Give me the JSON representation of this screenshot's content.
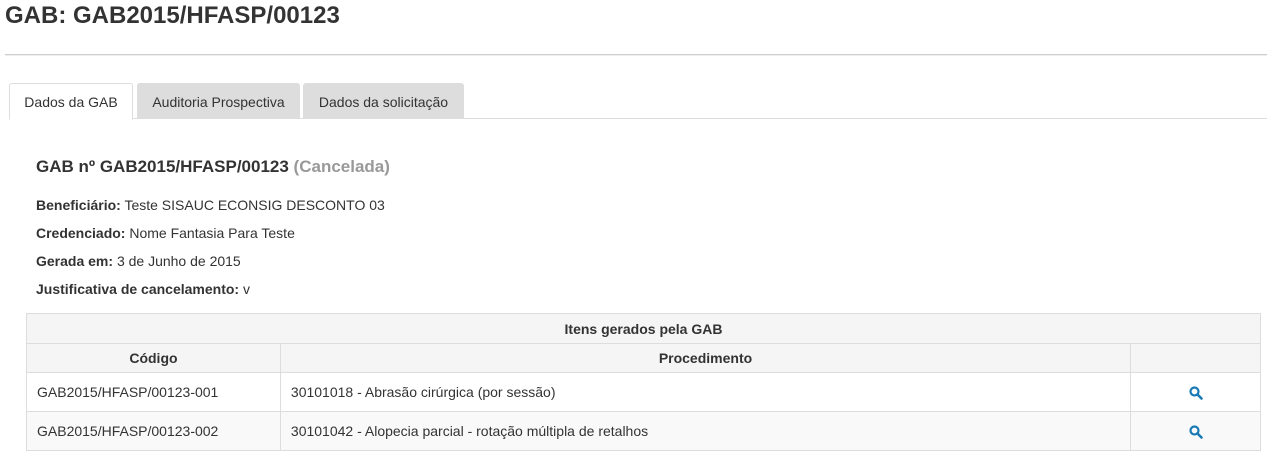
{
  "page": {
    "title": "GAB: GAB2015/HFASP/00123"
  },
  "tabs": [
    {
      "label": "Dados da GAB",
      "active": true
    },
    {
      "label": "Auditoria Prospectiva",
      "active": false
    },
    {
      "label": "Dados da solicitação",
      "active": false
    }
  ],
  "gab": {
    "heading": "GAB nº GAB2015/HFASP/00123",
    "status": "(Cancelada)",
    "fields": [
      {
        "label": "Beneficiário:",
        "value": "Teste SISAUC ECONSIG DESCONTO 03"
      },
      {
        "label": "Credenciado:",
        "value": "Nome Fantasia Para Teste"
      },
      {
        "label": "Gerada em:",
        "value": "3 de Junho de 2015"
      },
      {
        "label": "Justificativa de cancelamento:",
        "value": "v"
      }
    ]
  },
  "items_table": {
    "caption": "Itens gerados pela GAB",
    "columns": [
      "Código",
      "Procedimento",
      ""
    ],
    "rows": [
      {
        "code": "GAB2015/HFASP/00123-001",
        "procedure": "30101018 - Abrasão cirúrgica (por sessão)",
        "action_icon": "search-icon"
      },
      {
        "code": "GAB2015/HFASP/00123-002",
        "procedure": "30101042 - Alopecia parcial - rotação múltipla de retalhos",
        "action_icon": "search-icon"
      }
    ]
  },
  "colors": {
    "accent": "#1a7ab5",
    "status_text": "#999999",
    "tab_inactive": "#dddddd"
  }
}
